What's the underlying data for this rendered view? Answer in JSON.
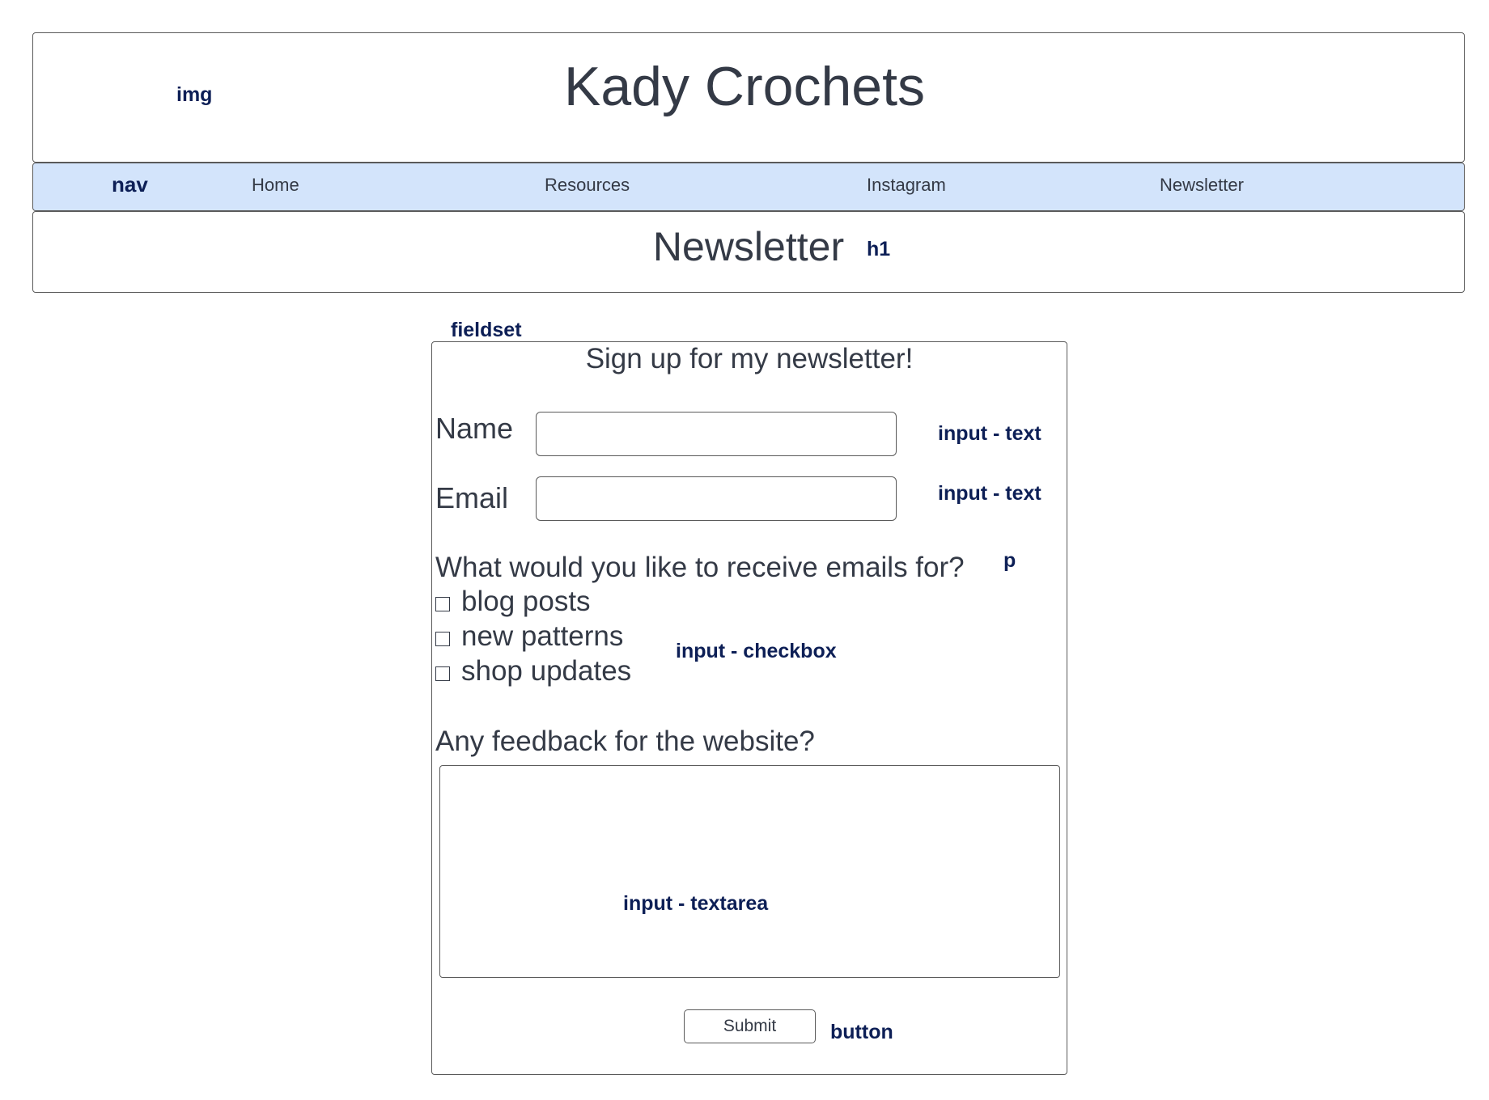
{
  "header": {
    "site_title": "Kady Crochets",
    "img_annotation": "img"
  },
  "nav": {
    "annotation": "nav",
    "links": [
      "Home",
      "Resources",
      "Instagram",
      "Newsletter"
    ],
    "background_color": "#d3e4fb"
  },
  "page": {
    "heading": "Newsletter",
    "h1_annotation": "h1"
  },
  "form": {
    "fieldset_annotation": "fieldset",
    "legend": "Sign up for my newsletter!",
    "name": {
      "label": "Name",
      "value": "",
      "annotation": "input - text"
    },
    "email": {
      "label": "Email",
      "value": "",
      "annotation": "input - text"
    },
    "interests": {
      "question": "What would you like to receive emails for?",
      "question_annotation": "p",
      "options": [
        {
          "label": "blog posts",
          "checked": false
        },
        {
          "label": "new patterns",
          "checked": false
        },
        {
          "label": "shop updates",
          "checked": false
        }
      ],
      "annotation": "input - checkbox"
    },
    "feedback": {
      "question": "Any feedback for the website?",
      "value": "",
      "annotation": "input - textarea"
    },
    "submit": {
      "label": "Submit",
      "annotation": "button"
    }
  },
  "colors": {
    "annotation_text": "#0d1f56",
    "body_text": "#343a46",
    "border": "#5a5a5a"
  }
}
